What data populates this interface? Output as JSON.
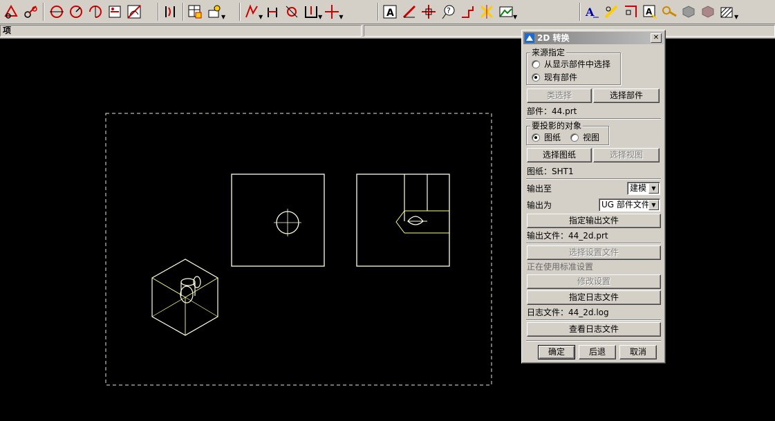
{
  "statusbar": {
    "left_text": "项"
  },
  "dialog": {
    "title": "2D 转换",
    "close_glyph": "✕",
    "source_group": {
      "label": "来源指定",
      "option_display": "从显示部件中选择",
      "option_existing": "现有部件",
      "selected": "existing"
    },
    "class_select_button": "类选择",
    "select_part_button": "选择部件",
    "part_label": "部件：44.prt",
    "project_group": {
      "label": "要投影的对象",
      "option_drawing": "图纸",
      "option_view": "视图",
      "selected": "drawing"
    },
    "select_drawing_button": "选择图纸",
    "select_view_button": "选择视图",
    "drawing_label": "图纸：SHT1",
    "output_to_label": "输出至",
    "output_to_value": "建模",
    "output_as_label": "输出为",
    "output_as_value": "UG 部件文件",
    "specify_output_button": "指定输出文件",
    "output_file_label": "输出文件：44_2d.prt",
    "select_settings_button": "选择设置文件",
    "using_standard_label": "正在使用标准设置",
    "modify_settings_button": "修改设置",
    "specify_log_button": "指定日志文件",
    "log_file_label": "日志文件：44_2d.log",
    "view_log_button": "查看日志文件",
    "ok_button": "确定",
    "back_button": "后退",
    "cancel_button": "取消"
  },
  "toolbar": {
    "icons": [
      "point-icon",
      "circle-point-icon",
      "arc-center-icon",
      "arc-endpoints-icon",
      "arc-icon",
      "section-view-icon",
      "detail-view-icon",
      "break-view-icon",
      "table-icon",
      "cog-icon",
      "dimension-icon",
      "leader-icon",
      "symbol-icon",
      "hole-icon",
      "crosshair-icon",
      "text-icon",
      "pencil-icon",
      "centerline-icon",
      "id-symbol-icon",
      "surface-finish-icon",
      "weld-icon",
      "image-icon",
      "text-style-icon",
      "edit-text-icon",
      "origin-icon",
      "annotation-icon",
      "key-icon",
      "cube-icon",
      "cube-gray-icon",
      "hatch-icon"
    ]
  },
  "colors": {
    "canvas": "#000000",
    "geometry": "#ffffe0",
    "highlight": "#ffff66",
    "dialog_bg": "#d4d0c8"
  }
}
